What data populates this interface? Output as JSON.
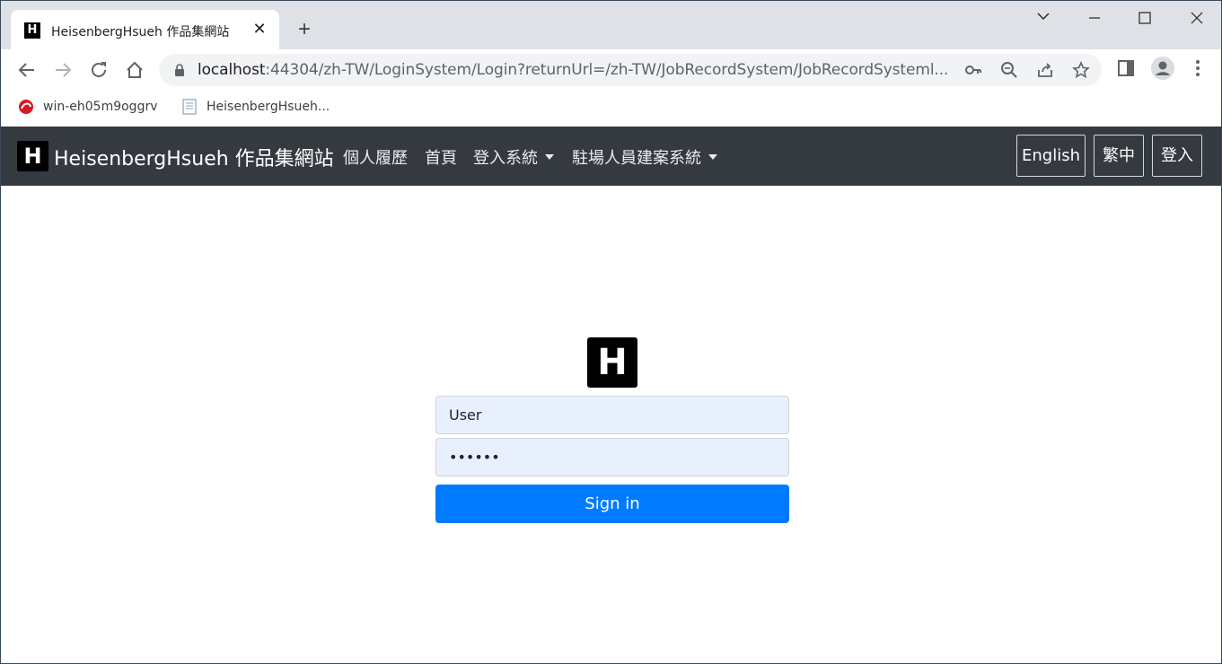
{
  "browser": {
    "tab": {
      "title": "HeisenbergHsueh 作品集網站",
      "favicon_letter": "H"
    },
    "address": {
      "host": "localhost",
      "rest": ":44304/zh-TW/LoginSystem/Login?returnUrl=/zh-TW/JobRecordSystem/JobRecordSysteml..."
    },
    "bookmarks": [
      {
        "label": "win-eh05m9oggrv",
        "icon": "trend-micro-icon"
      },
      {
        "label": "HeisenbergHsueh...",
        "icon": "page-icon"
      }
    ]
  },
  "site": {
    "brand": {
      "logo_letter": "H",
      "name": "HeisenbergHsueh 作品集網站"
    },
    "nav": {
      "resume": "個人履歷",
      "home": "首頁",
      "login_system": "登入系統",
      "onsite_system": "駐場人員建案系統"
    },
    "lang": {
      "english": "English",
      "trad_chinese": "繁中"
    },
    "login_link": "登入",
    "colors": {
      "navbar_bg": "#343a40",
      "primary": "#007bff",
      "autofill_bg": "#e8f0fe"
    }
  },
  "login": {
    "logo_letter": "H",
    "username_value": "User",
    "password_value": "••••••",
    "submit_label": "Sign in"
  }
}
